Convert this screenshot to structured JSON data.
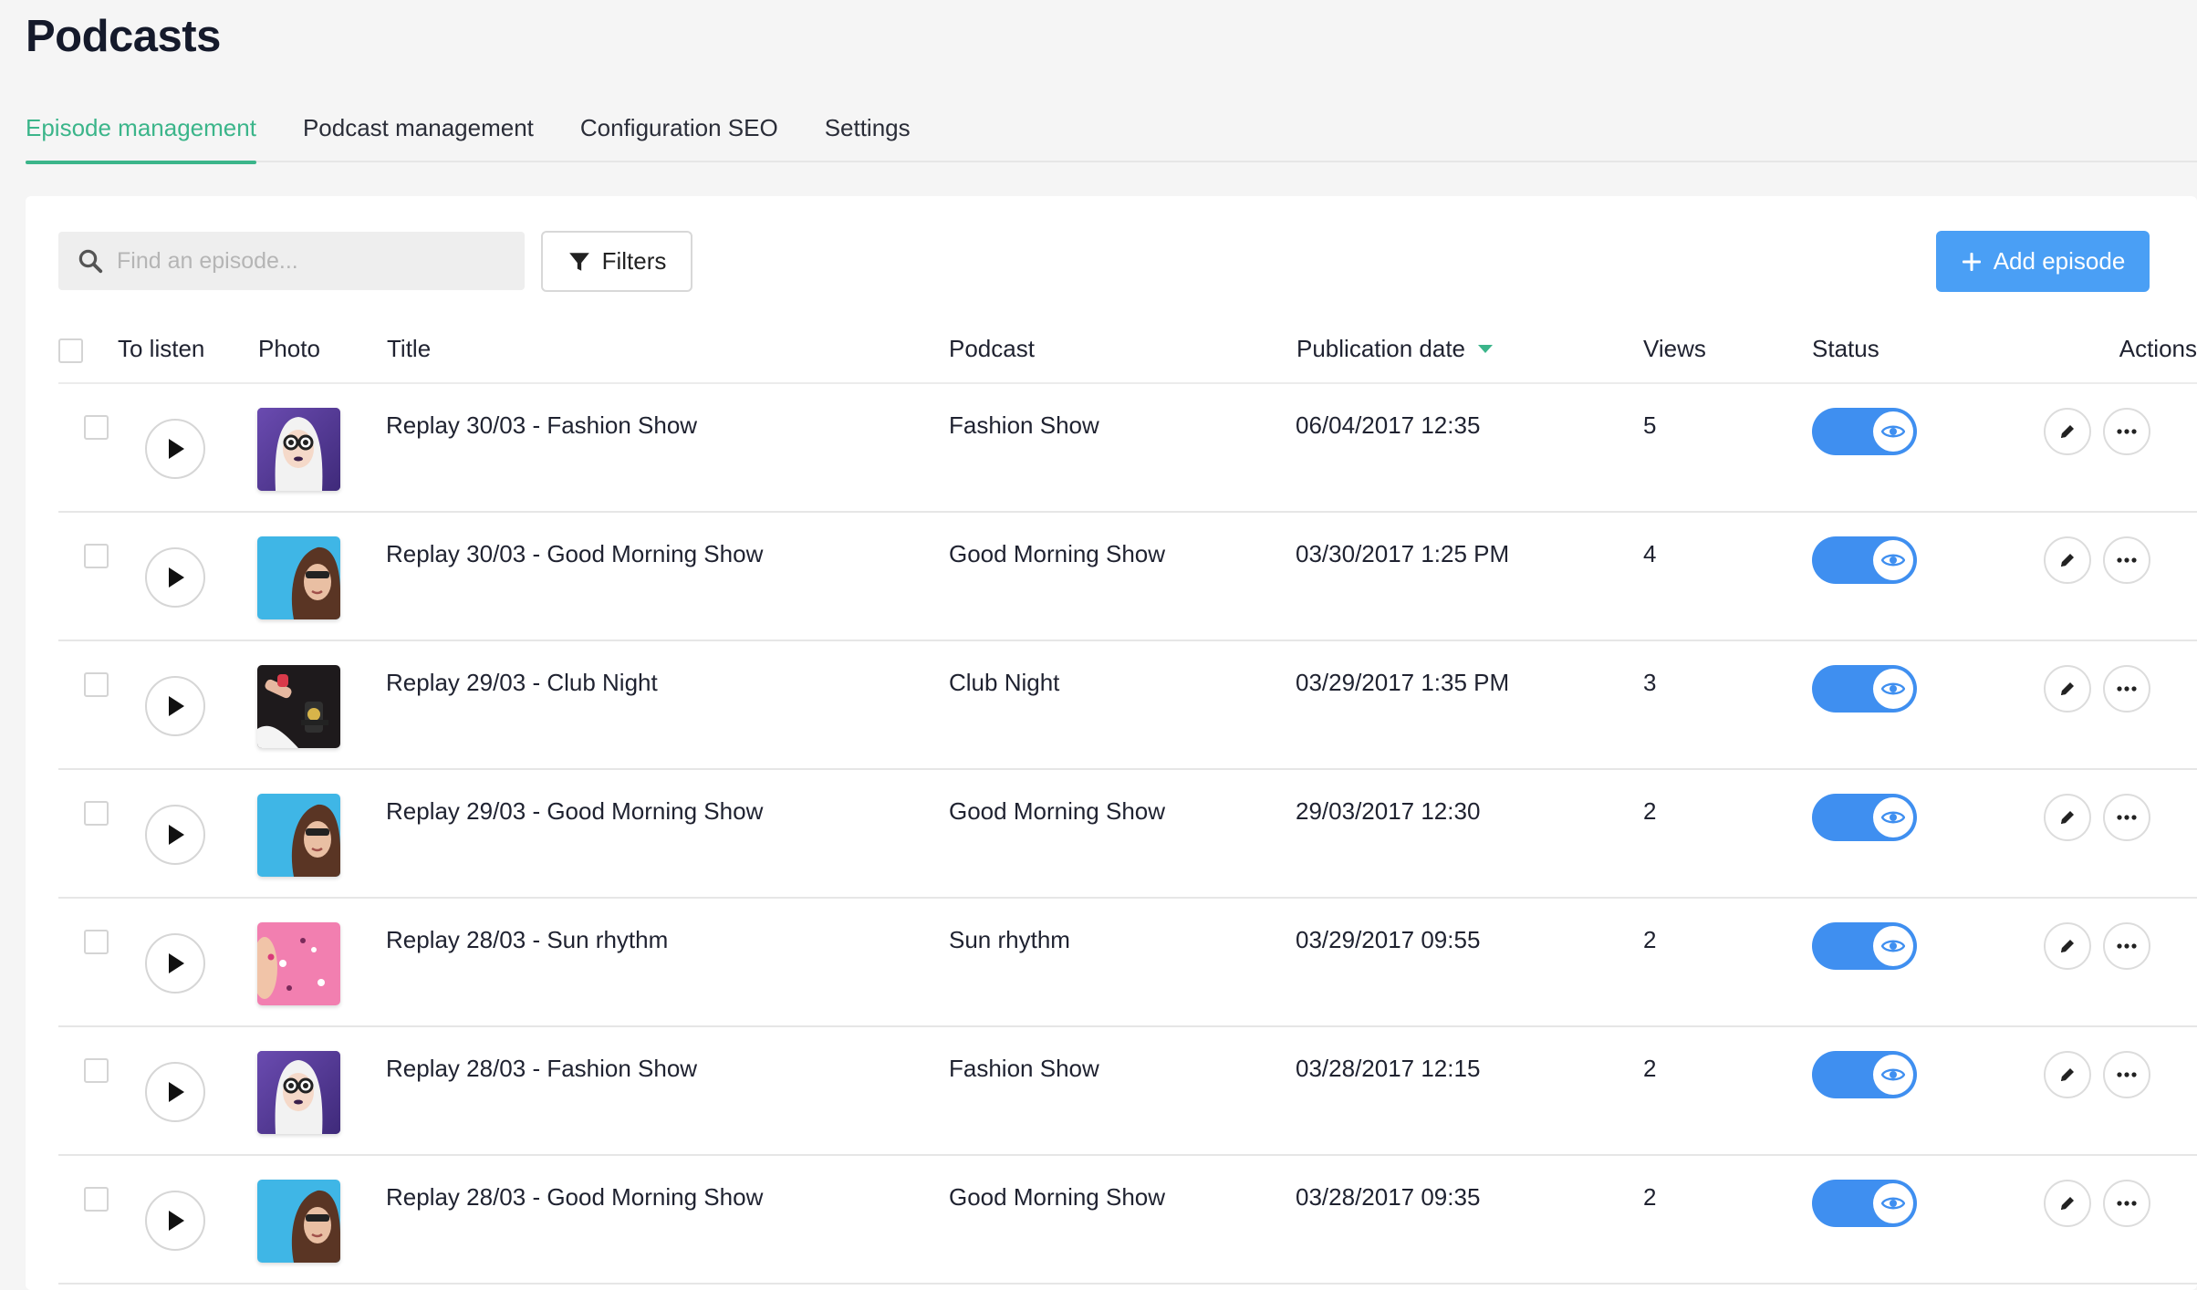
{
  "page": {
    "title": "Podcasts"
  },
  "tabs": [
    {
      "label": "Episode management",
      "active": true
    },
    {
      "label": "Podcast management",
      "active": false
    },
    {
      "label": "Configuration SEO",
      "active": false
    },
    {
      "label": "Settings",
      "active": false
    }
  ],
  "toolbar": {
    "search_placeholder": "Find an episode...",
    "filters_label": "Filters",
    "add_label": "Add episode"
  },
  "table": {
    "columns": {
      "to_listen": "To listen",
      "photo": "Photo",
      "title": "Title",
      "podcast": "Podcast",
      "publication_date": "Publication date",
      "views": "Views",
      "status": "Status",
      "actions": "Actions"
    },
    "sort": {
      "column": "publication_date",
      "direction": "desc"
    },
    "rows": [
      {
        "title": "Replay 30/03 - Fashion Show",
        "podcast": "Fashion Show",
        "date": "06/04/2017 12:35",
        "views": "5",
        "thumb": "fashion",
        "status": "visible"
      },
      {
        "title": "Replay 30/03 - Good Morning Show",
        "podcast": "Good Morning Show",
        "date": "03/30/2017 1:25 PM",
        "views": "4",
        "thumb": "morning",
        "status": "visible"
      },
      {
        "title": "Replay 29/03 - Club Night",
        "podcast": "Club Night",
        "date": "03/29/2017 1:35 PM",
        "views": "3",
        "thumb": "club",
        "status": "visible"
      },
      {
        "title": "Replay 29/03 - Good Morning Show",
        "podcast": "Good Morning Show",
        "date": "29/03/2017 12:30",
        "views": "2",
        "thumb": "morning",
        "status": "visible"
      },
      {
        "title": "Replay 28/03 - Sun rhythm",
        "podcast": "Sun rhythm",
        "date": "03/29/2017 09:55",
        "views": "2",
        "thumb": "sun",
        "status": "visible"
      },
      {
        "title": "Replay 28/03 - Fashion Show",
        "podcast": "Fashion Show",
        "date": "03/28/2017 12:15",
        "views": "2",
        "thumb": "fashion",
        "status": "visible"
      },
      {
        "title": "Replay 28/03 - Good Morning Show",
        "podcast": "Good Morning Show",
        "date": "03/28/2017 09:35",
        "views": "2",
        "thumb": "morning",
        "status": "visible"
      }
    ]
  },
  "colors": {
    "accent_tab": "#3bb58a",
    "primary_button": "#4a9ff5",
    "toggle_on": "#3f8ff0"
  },
  "icons": {
    "search": "search-icon",
    "filter": "filter-icon",
    "add": "plus-icon",
    "sort": "sort-desc-icon",
    "play": "play-icon",
    "status": "eye-icon",
    "edit": "pencil-icon",
    "more": "more-horizontal-icon"
  }
}
